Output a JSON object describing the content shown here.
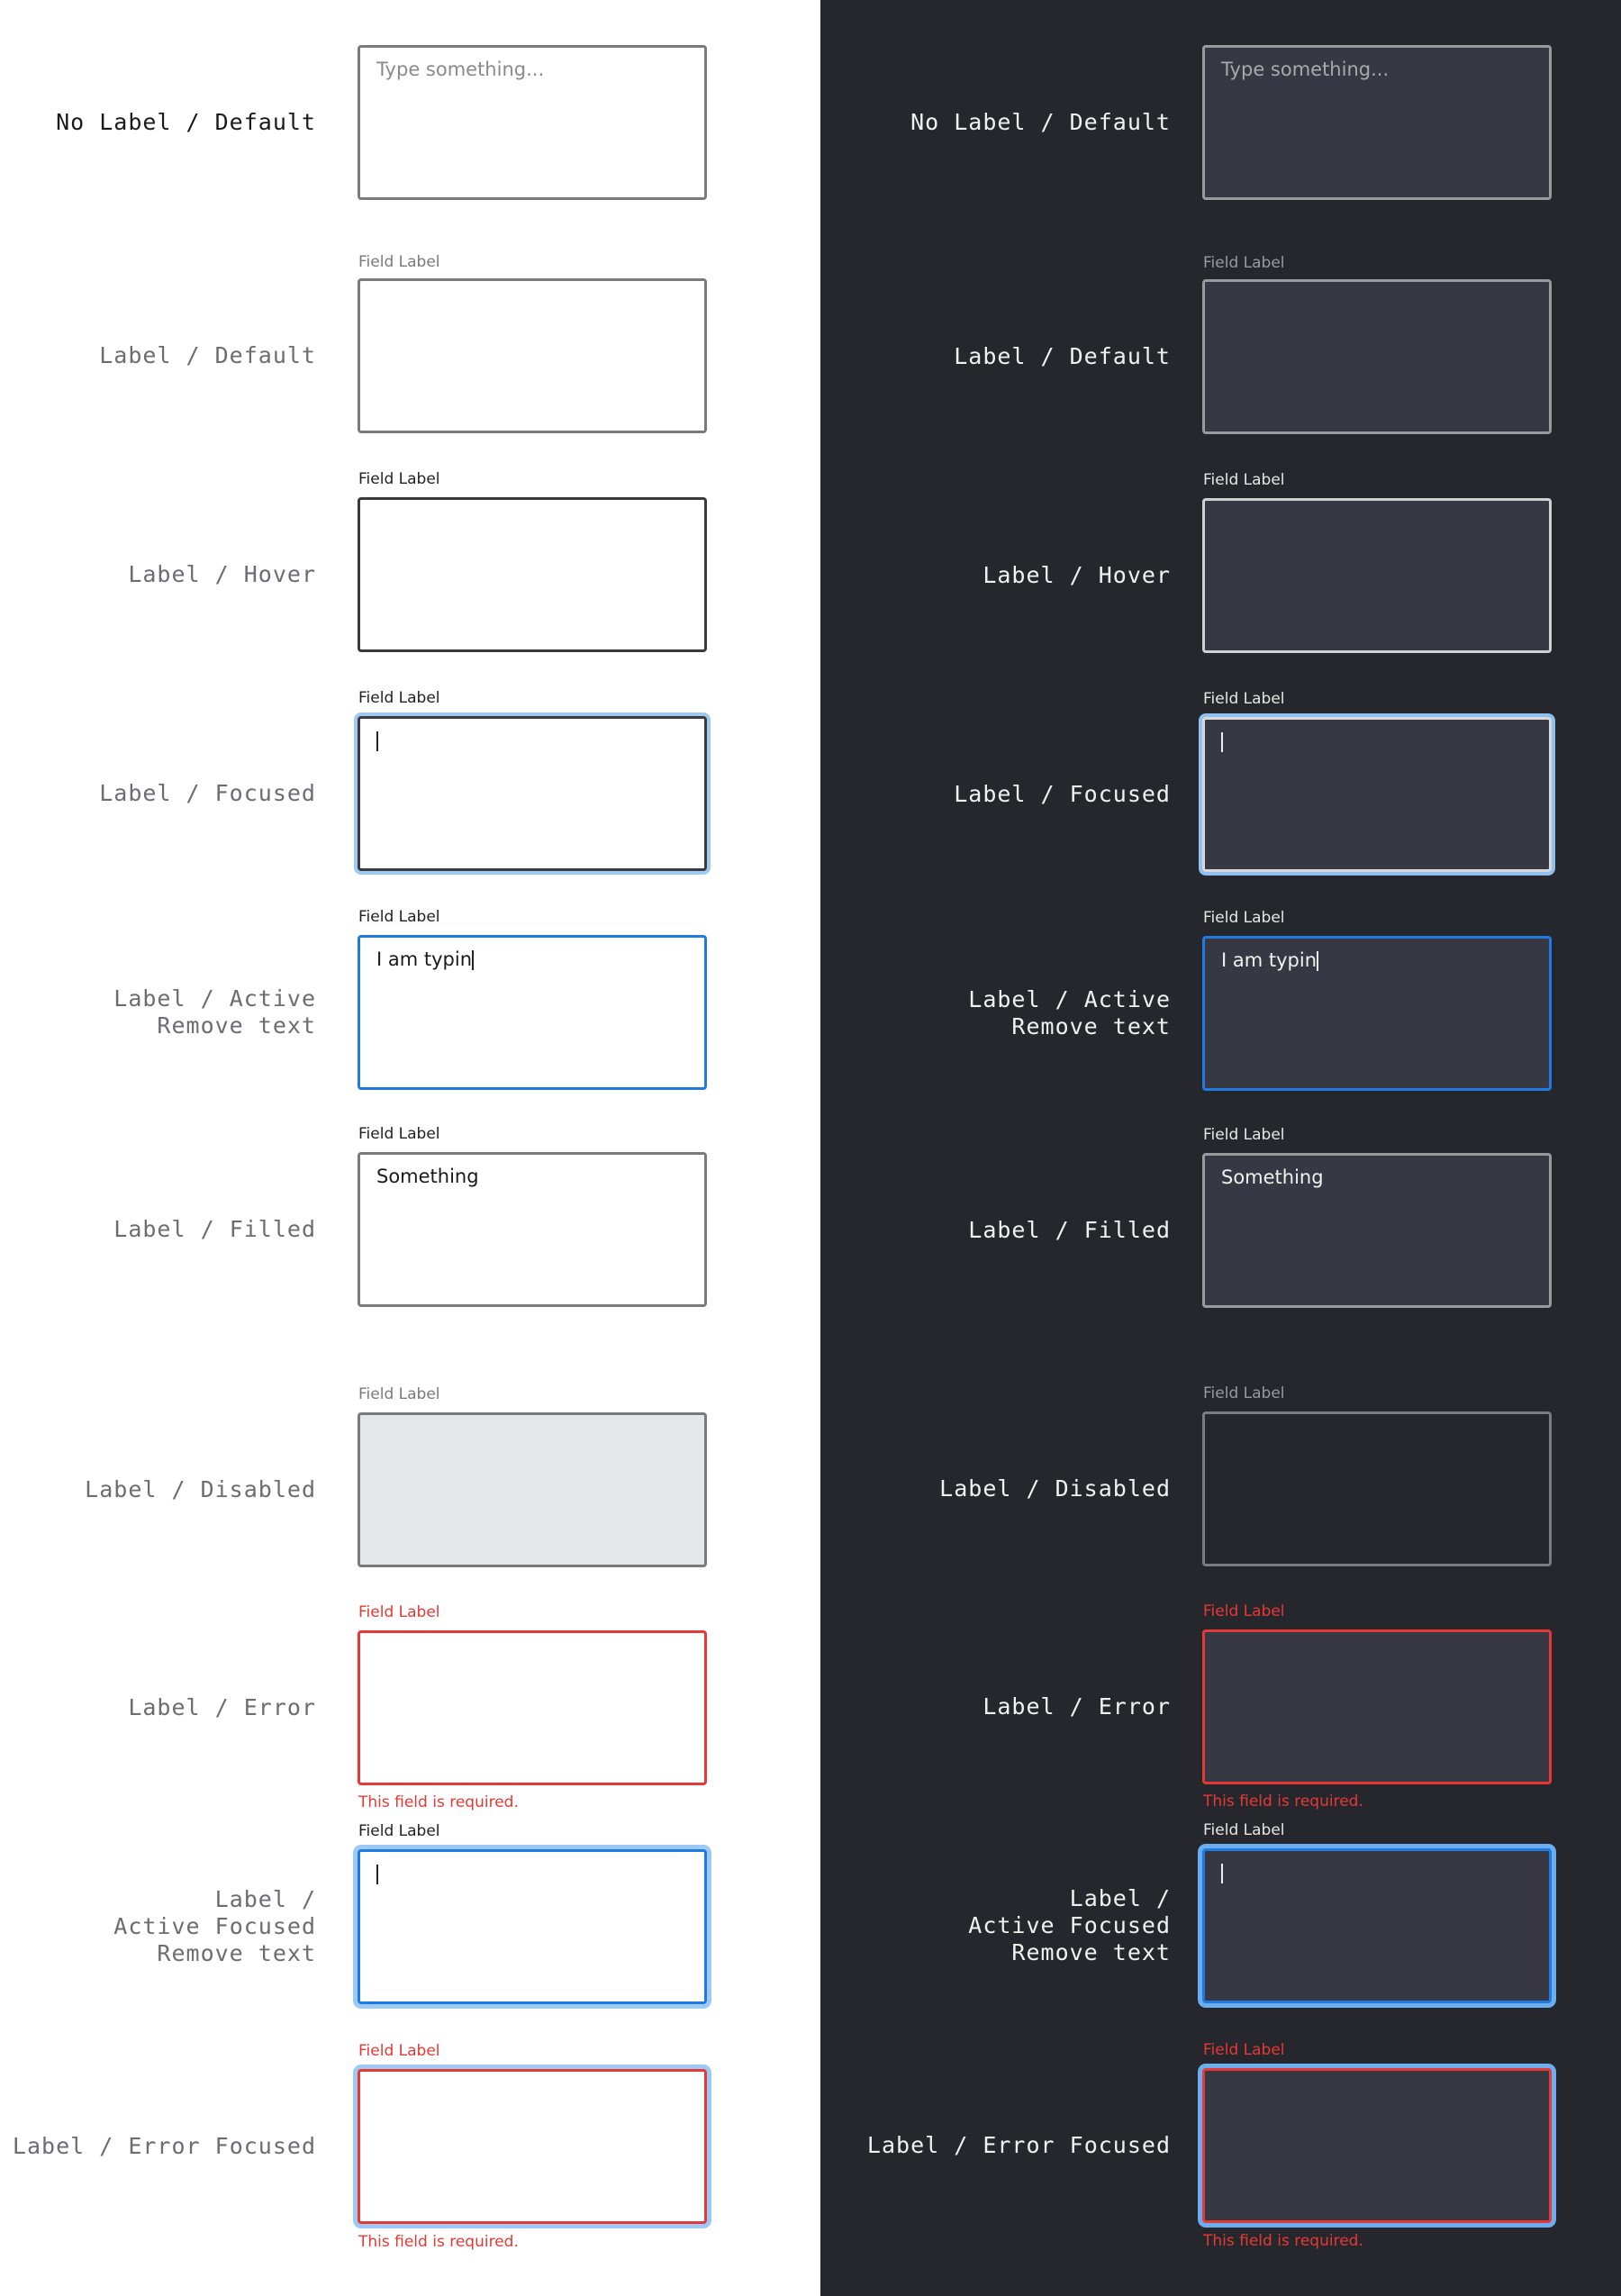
{
  "field_label": "Field Label",
  "placeholder": "Type something...",
  "error_message": "This field is required.",
  "states": {
    "no_label_default": "No Label / Default",
    "label_default": "Label / Default",
    "label_hover": "Label / Hover",
    "label_focused": "Label / Focused",
    "label_active": "Label / Active\nRemove text",
    "label_filled": "Label / Filled",
    "label_disabled": "Label / Disabled",
    "label_error": "Label / Error",
    "label_active_focused": "Label / \nActive Focused\nRemove text",
    "label_error_focused": "Label / Error Focused"
  },
  "values": {
    "active": "I am typin",
    "filled": "Something"
  },
  "colors": {
    "light_bg": "#ffffff",
    "dark_bg": "#26272c",
    "dark_field": "#373843",
    "accent_blue": "#1f7be2",
    "focus_ring": "#9ccaf4",
    "error_red": "#e53935"
  },
  "themes": [
    "light",
    "dark"
  ]
}
